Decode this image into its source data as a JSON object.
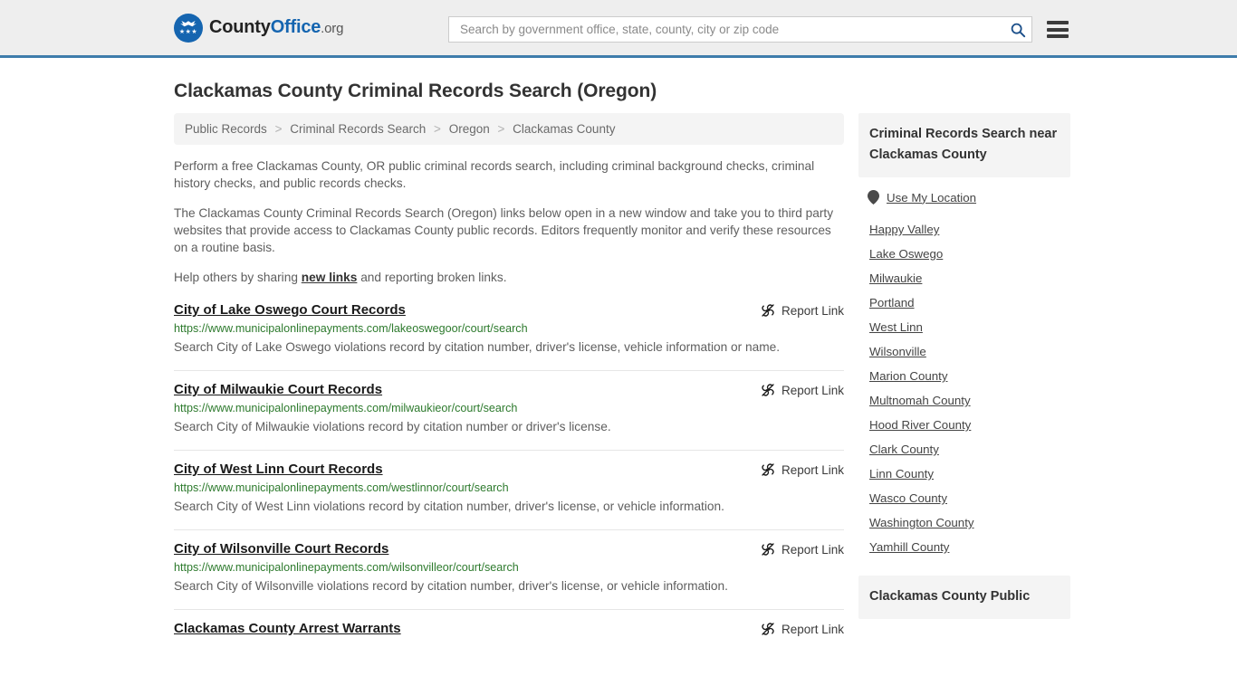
{
  "header": {
    "logo": {
      "name_part1": "County",
      "name_part2": "Office",
      "suffix": ".org",
      "stars": "★★★"
    },
    "search": {
      "placeholder": "Search by government office, state, county, city or zip code",
      "value": ""
    }
  },
  "page": {
    "title": "Clackamas County Criminal Records Search (Oregon)"
  },
  "breadcrumb": {
    "items": [
      {
        "label": "Public Records"
      },
      {
        "label": "Criminal Records Search"
      },
      {
        "label": "Oregon"
      },
      {
        "label": "Clackamas County"
      }
    ],
    "separator": ">"
  },
  "intro": {
    "p1": "Perform a free Clackamas County, OR public criminal records search, including criminal background checks, criminal history checks, and public records checks.",
    "p2": "The Clackamas County Criminal Records Search (Oregon) links below open in a new window and take you to third party websites that provide access to Clackamas County public records. Editors frequently monitor and verify these resources on a routine basis.",
    "p3_before": "Help others by sharing ",
    "p3_link": "new links",
    "p3_after": " and reporting broken links."
  },
  "results": {
    "report_label": "Report Link",
    "items": [
      {
        "title": "City of Lake Oswego Court Records",
        "url": "https://www.municipalonlinepayments.com/lakeoswegoor/court/search",
        "description": "Search City of Lake Oswego violations record by citation number, driver's license, vehicle information or name."
      },
      {
        "title": "City of Milwaukie Court Records",
        "url": "https://www.municipalonlinepayments.com/milwaukieor/court/search",
        "description": "Search City of Milwaukie violations record by citation number or driver's license."
      },
      {
        "title": "City of West Linn Court Records",
        "url": "https://www.municipalonlinepayments.com/westlinnor/court/search",
        "description": "Search City of West Linn violations record by citation number, driver's license, or vehicle information."
      },
      {
        "title": "City of Wilsonville Court Records",
        "url": "https://www.municipalonlinepayments.com/wilsonvilleor/court/search",
        "description": "Search City of Wilsonville violations record by citation number, driver's license, or vehicle information."
      },
      {
        "title": "Clackamas County Arrest Warrants",
        "url": "",
        "description": ""
      }
    ]
  },
  "sidebar": {
    "panel_title": "Criminal Records Search near Clackamas County",
    "use_my_location": "Use My Location",
    "links": [
      {
        "label": "Happy Valley"
      },
      {
        "label": "Lake Oswego"
      },
      {
        "label": "Milwaukie"
      },
      {
        "label": "Portland"
      },
      {
        "label": "West Linn"
      },
      {
        "label": "Wilsonville"
      },
      {
        "label": "Marion County"
      },
      {
        "label": "Multnomah County"
      },
      {
        "label": "Hood River County"
      },
      {
        "label": "Clark County"
      },
      {
        "label": "Linn County"
      },
      {
        "label": "Wasco County"
      },
      {
        "label": "Washington County"
      },
      {
        "label": "Yamhill County"
      }
    ],
    "next_panel_title": "Clackamas County Public"
  },
  "colors": {
    "brand_blue": "#1565b0",
    "header_rule": "#3e7cab",
    "url_green": "#2d7a2d",
    "panel_gray": "#f4f4f4"
  }
}
